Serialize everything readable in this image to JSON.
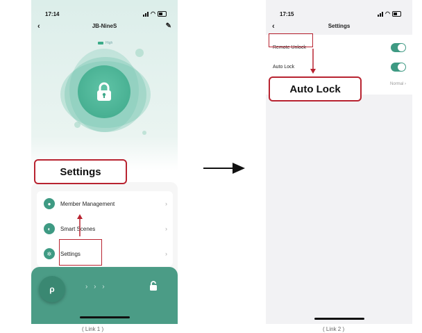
{
  "phone1": {
    "status_time": "17:14",
    "nav_title": "JB-NineS",
    "battery_label": "High",
    "menu": [
      {
        "label": "Member Management"
      },
      {
        "label": "Smart Scenes"
      },
      {
        "label": "Settings"
      }
    ],
    "slide_hint": "› › ›",
    "callout": "Settings",
    "caption": "( Link 1 )"
  },
  "phone2": {
    "status_time": "17:15",
    "nav_title": "Settings",
    "rows": [
      {
        "label": "Remote Unlock",
        "toggle_on": true
      },
      {
        "label": "Auto Lock",
        "toggle_on": true
      }
    ],
    "auto_lock_value": "Normal ›",
    "callout": "Auto Lock",
    "caption": "( Link 2 )"
  },
  "colors": {
    "accent_green": "#3e9a83",
    "annotation_red": "#b82330"
  }
}
